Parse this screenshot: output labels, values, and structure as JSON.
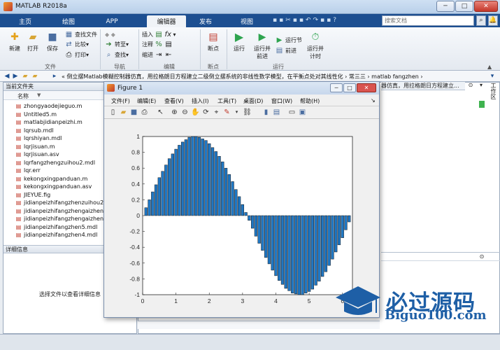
{
  "window": {
    "title": "MATLAB R2018a"
  },
  "tabs": [
    "主页",
    "绘图",
    "APP",
    "编辑器",
    "发布",
    "视图"
  ],
  "search": {
    "placeholder": "搜索文档"
  },
  "ribbon": {
    "new_label": "新建",
    "open_label": "打开",
    "save_label": "保存",
    "find_files": "查找文件",
    "compare": "比较",
    "print": "打印",
    "goto": "转至",
    "find": "查找",
    "insert": "插入",
    "comment": "注释",
    "indent": "缩进",
    "breakpoints": "断点",
    "run": "运行",
    "run_advance": "运行并\n前进",
    "run_section": "运行节",
    "advance": "前进",
    "run_time": "运行并\n计时",
    "sections": {
      "file": "文件",
      "navigate": "导航",
      "edit": "编辑",
      "breakpoints": "断点",
      "run": "运行"
    }
  },
  "address": {
    "path": "« 倒立摆Matlab模糊控制器仿真，用拉格朗日方程建立二级倒立摆系统的非线性数学模型，在平衡点处对其线性化 › 常三三 › matlab fangzhen ›"
  },
  "left_panel": {
    "title": "当前文件夹",
    "name_col": "名称",
    "files": [
      "zhongyaodejieguo.m",
      "Untitled5.m",
      "matlabjidianpeizhi.m",
      "lqrsub.mdl",
      "lqrshiyan.mdl",
      "lqrjisuan.m",
      "lqrjisuan.asv",
      "lqrfangzhengzuihou2.mdl",
      "lqr.err",
      "kekongxingpanduan.m",
      "kekongxingpanduan.asv",
      "JIEYUE.fig",
      "jidianpeizhifangzhenzuihou2.",
      "jidianpeizhifangzhengaizheng",
      "jidianpeizhifangzhengaizheng",
      "jidianpeizhifangzhen5.mdl",
      "jidianpeizhifangzhen4.mdl"
    ],
    "details_title": "详细信息",
    "details_text": "选择文件以查看详细信息"
  },
  "right": {
    "cmd_title": "器仿真，用拉格朗日方程建立...",
    "ws_title": "工作区"
  },
  "figure": {
    "title": "Figure 1",
    "menu": [
      "文件(F)",
      "编辑(E)",
      "查看(V)",
      "插入(I)",
      "工具(T)",
      "桌面(D)",
      "窗口(W)",
      "帮助(H)"
    ]
  },
  "chart_data": {
    "type": "bar",
    "x": [
      0.1,
      0.2,
      0.3,
      0.4,
      0.5,
      0.6,
      0.7,
      0.8,
      0.9,
      1.0,
      1.1,
      1.2,
      1.3,
      1.4,
      1.5,
      1.6,
      1.7,
      1.8,
      1.9,
      2.0,
      2.1,
      2.2,
      2.3,
      2.4,
      2.5,
      2.6,
      2.7,
      2.8,
      2.9,
      3.0,
      3.1,
      3.2,
      3.3,
      3.4,
      3.5,
      3.6,
      3.7,
      3.8,
      3.9,
      4.0,
      4.1,
      4.2,
      4.3,
      4.4,
      4.5,
      4.6,
      4.7,
      4.8,
      4.9,
      5.0,
      5.1,
      5.2,
      5.3,
      5.4,
      5.5,
      5.6,
      5.7,
      5.8,
      5.9,
      6.0,
      6.1,
      6.2
    ],
    "values": [
      0.1,
      0.2,
      0.3,
      0.39,
      0.48,
      0.56,
      0.64,
      0.72,
      0.78,
      0.84,
      0.89,
      0.93,
      0.96,
      0.99,
      1.0,
      1.0,
      0.99,
      0.97,
      0.95,
      0.91,
      0.86,
      0.81,
      0.75,
      0.68,
      0.6,
      0.52,
      0.43,
      0.33,
      0.24,
      0.14,
      0.04,
      -0.06,
      -0.16,
      -0.26,
      -0.35,
      -0.44,
      -0.53,
      -0.61,
      -0.69,
      -0.76,
      -0.82,
      -0.87,
      -0.92,
      -0.95,
      -0.98,
      -0.99,
      -1.0,
      -1.0,
      -0.98,
      -0.96,
      -0.93,
      -0.88,
      -0.83,
      -0.77,
      -0.71,
      -0.63,
      -0.55,
      -0.46,
      -0.37,
      -0.28,
      -0.18,
      -0.08
    ],
    "xlim": [
      0,
      6.3
    ],
    "ylim": [
      -1,
      1
    ],
    "xticks": [
      0,
      1,
      2,
      3,
      4,
      5,
      6
    ],
    "yticks": [
      1,
      0.8,
      0.6,
      0.4,
      0.2,
      0,
      -0.2,
      -0.4,
      -0.6,
      -0.8,
      -1
    ],
    "ytick_labels": [
      "1",
      "0.8",
      "0.6",
      "0.4",
      "0.2",
      "0",
      "-0.2",
      "-0.4",
      "-0.6",
      "-0.8",
      "-1"
    ],
    "xtick_labels": [
      "0",
      "1",
      "2",
      "3",
      "4",
      "5",
      "6"
    ],
    "bar_color": "#1f77c4"
  },
  "watermark": {
    "text": "必过源码",
    "url": "Biguo100.com"
  }
}
